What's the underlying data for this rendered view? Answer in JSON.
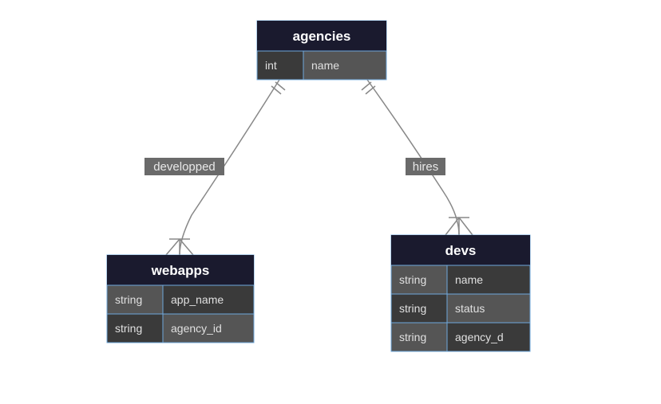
{
  "entities": {
    "agencies": {
      "title": "agencies",
      "rows": [
        {
          "type": "int",
          "name": "name"
        }
      ]
    },
    "webapps": {
      "title": "webapps",
      "rows": [
        {
          "type": "string",
          "name": "app_name"
        },
        {
          "type": "string",
          "name": "agency_id"
        }
      ]
    },
    "devs": {
      "title": "devs",
      "rows": [
        {
          "type": "string",
          "name": "name"
        },
        {
          "type": "string",
          "name": "status"
        },
        {
          "type": "string",
          "name": "agency_d"
        }
      ]
    }
  },
  "relations": {
    "developped": {
      "label": "developped"
    },
    "hires": {
      "label": "hires"
    }
  }
}
